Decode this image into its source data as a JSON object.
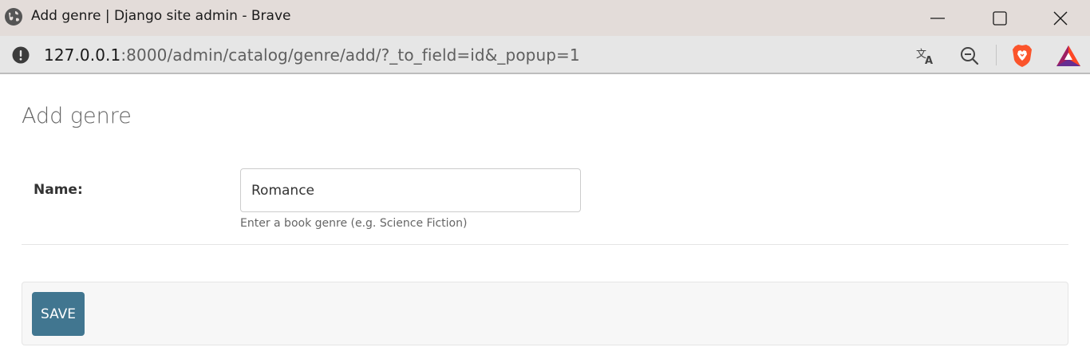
{
  "window": {
    "title": "Add genre | Django site admin - Brave"
  },
  "addressbar": {
    "url_host": "127.0.0.1",
    "url_rest": ":8000/admin/catalog/genre/add/?_to_field=id&_popup=1"
  },
  "icons": {
    "site": "globe-icon",
    "info": "info-icon",
    "translate": "translate-icon",
    "zoom": "zoom-out-icon",
    "shields": "brave-shields-icon",
    "rewards": "brave-rewards-icon"
  },
  "page": {
    "title": "Add genre",
    "name_label": "Name:",
    "name_value": "Romance",
    "name_help": "Enter a book genre (e.g. Science Fiction)",
    "save_label": "SAVE"
  },
  "colors": {
    "titlebar": "#e3dcd9",
    "addressbar": "#e6e6e6",
    "save_button": "#417690",
    "brave_orange": "#fb542b"
  }
}
